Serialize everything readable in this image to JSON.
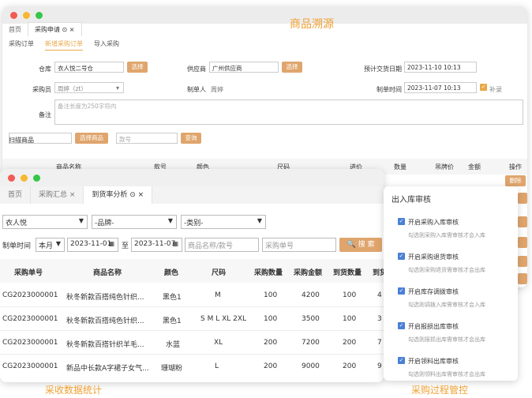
{
  "top_window": {
    "tabs": [
      "首页",
      "采购申请 ⊙ ×"
    ],
    "subtabs": [
      "采购订单",
      "新增采购订单",
      "导入采购"
    ],
    "form": {
      "warehouse_label": "仓库",
      "warehouse_value": "衣人悦二号仓",
      "warehouse_btn": "选择",
      "supplier_label": "供应商",
      "supplier_value": "广州供应商",
      "supplier_btn": "选择",
      "expected_date_label": "预计交货日期",
      "expected_date_value": "2023-11-10 10:13",
      "buyer_label": "采购员",
      "buyer_value": "周婷（zt）",
      "maker_label": "制单人",
      "maker_value": "周婷",
      "make_time_label": "制单时间",
      "make_time_value": "2023-11-07 10:13",
      "supplement_label": "补录",
      "remark_label": "备注",
      "remark_placeholder": "备注长度为250字符内",
      "scan_label": "扫描商品",
      "select_goods_btn": "选择商品",
      "query_placeholder": "款号",
      "query_btn": "查询"
    },
    "table_headers": [
      "商品名称",
      "款号",
      "颜色",
      "尺码",
      "进价",
      "数量",
      "吊牌价",
      "金额",
      "操作"
    ],
    "delete_btn": "删除"
  },
  "headline_top": "商品溯源",
  "stats_window": {
    "tabs": [
      "首页",
      "采购汇总 ×",
      "到货率分析 ⊙ ×"
    ],
    "filters": {
      "store": "衣人悦",
      "brand": "-品牌-",
      "category": "-类别-",
      "time_label": "制单时间",
      "period": "本月",
      "date_from": "2023-11-01",
      "to_label": "至",
      "date_to": "2023-11-07",
      "goods_placeholder": "商品名称/款号",
      "order_placeholder": "采购单号",
      "search_btn": "搜 索"
    },
    "headers": [
      "采购单号",
      "商品名称",
      "颜色",
      "尺码",
      "采购数量",
      "采购金额",
      "到货数量",
      "到货"
    ],
    "rows": [
      [
        "CG2023000001",
        "秋冬新款百搭纯色针织...",
        "黑色1",
        "M",
        "100",
        "4200",
        "100",
        "4"
      ],
      [
        "CG2023000001",
        "秋冬新款百搭纯色针织...",
        "黑色1",
        "S M L XL 2XL",
        "100",
        "3500",
        "100",
        "3"
      ],
      [
        "CG2023000001",
        "秋冬新款百搭针织羊毛...",
        "水蓝",
        "XL",
        "200",
        "7200",
        "200",
        "7"
      ],
      [
        "CG2023000001",
        "新品中长款A字裙子女气...",
        "珊瑚粉",
        "L",
        "200",
        "9000",
        "200",
        "9"
      ]
    ]
  },
  "audit_panel": {
    "title": "出入库审核",
    "items": [
      {
        "label": "开启采购入库审核",
        "desc": "勾选则采购入库需审核才会入库"
      },
      {
        "label": "开启采购退货审核",
        "desc": "勾选则采购退货需审核才会出库"
      },
      {
        "label": "开启库存调拨审核",
        "desc": "勾选则调拨入库需审核才会入库"
      },
      {
        "label": "开启报损出库审核",
        "desc": "勾选则报损出库需审核才会出库"
      },
      {
        "label": "开启领料出库审核",
        "desc": "勾选则领料出库需审核才会出库"
      }
    ]
  },
  "captions": {
    "left": "采收数据统计",
    "right": "采购过程管控"
  },
  "colors": {
    "accent": "#f0a032",
    "button": "#dfa56d",
    "check": "#4a7fd6"
  }
}
